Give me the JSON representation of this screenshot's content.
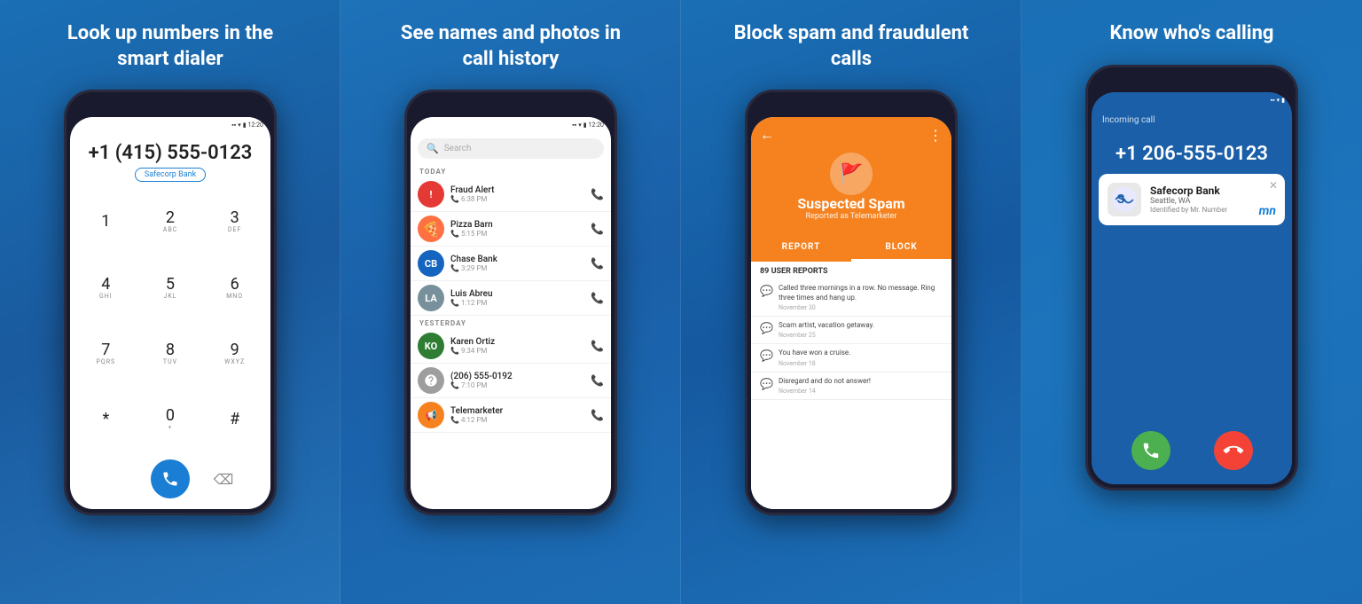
{
  "panels": [
    {
      "id": "panel-1",
      "title": "Look up numbers in the smart dialer",
      "dialer": {
        "number": "+1 (415) 555-0123",
        "contact_name": "Safecorp Bank",
        "status_time": "12:20",
        "keys": [
          {
            "num": "1",
            "letters": ""
          },
          {
            "num": "2",
            "letters": "ABC"
          },
          {
            "num": "3",
            "letters": "DEF"
          },
          {
            "num": "4",
            "letters": "GHI"
          },
          {
            "num": "5",
            "letters": "JKL"
          },
          {
            "num": "6",
            "letters": "MNO"
          },
          {
            "num": "7",
            "letters": "PQRS"
          },
          {
            "num": "8",
            "letters": "TUV"
          },
          {
            "num": "9",
            "letters": "WXYZ"
          },
          {
            "num": "*",
            "letters": ""
          },
          {
            "num": "0",
            "letters": "+"
          },
          {
            "num": "#",
            "letters": ""
          }
        ]
      }
    },
    {
      "id": "panel-2",
      "title": "See names and photos in call history",
      "history": {
        "status_time": "12:20",
        "search_placeholder": "Search",
        "sections": [
          {
            "label": "TODAY",
            "items": [
              {
                "name": "Fraud Alert",
                "time": "6:38 PM",
                "avatar_text": "!",
                "avatar_bg": "#e53935",
                "icon_type": "warning"
              },
              {
                "name": "Pizza Barn",
                "time": "5:15 PM",
                "avatar_text": "🍕",
                "avatar_bg": "#ff7043",
                "icon_type": "photo"
              },
              {
                "name": "Chase Bank",
                "time": "3:29 PM",
                "avatar_text": "CB",
                "avatar_bg": "#1565c0",
                "icon_type": "initials"
              },
              {
                "name": "Luis Abreu",
                "time": "1:12 PM",
                "avatar_text": "LA",
                "avatar_bg": "#78909c",
                "icon_type": "photo"
              }
            ]
          },
          {
            "label": "YESTERDAY",
            "items": [
              {
                "name": "Karen Ortiz",
                "time": "9:34 PM",
                "avatar_text": "KO",
                "avatar_bg": "#2e7d32",
                "icon_type": "initials"
              },
              {
                "name": "(206) 555-0192",
                "time": "7:10 PM",
                "avatar_text": "?",
                "avatar_bg": "#9e9e9e",
                "icon_type": "unknown"
              },
              {
                "name": "Telemarketer",
                "time": "4:12 PM",
                "avatar_text": "📢",
                "avatar_bg": "#f5821f",
                "icon_type": "spam"
              }
            ]
          }
        ]
      }
    },
    {
      "id": "panel-3",
      "title": "Block spam and fraudulent calls",
      "spam": {
        "header_label": "Suspected Spam",
        "header_sub": "Reported as Telemarketer",
        "report_btn": "REPORT",
        "block_btn": "BLOCK",
        "user_reports_label": "89 USER REPORTS",
        "reports": [
          {
            "text": "Called three mornings in a row. No message.  Ring three times and hang up.",
            "date": "November 30"
          },
          {
            "text": "Scam artist, vacation getaway.",
            "date": "November 25"
          },
          {
            "text": "You have won a cruise.",
            "date": "November 18"
          },
          {
            "text": "Disregard and do not answer!",
            "date": "November 14"
          }
        ]
      }
    },
    {
      "id": "panel-4",
      "title": "Know who's calling",
      "incoming": {
        "label": "Incoming call",
        "number": "+1 206-555-0123",
        "caller_name": "Safecorp Bank",
        "caller_location": "Seattle, WA",
        "caller_source": "Identified by Mr. Number",
        "mn_logo": "mn"
      }
    }
  ]
}
